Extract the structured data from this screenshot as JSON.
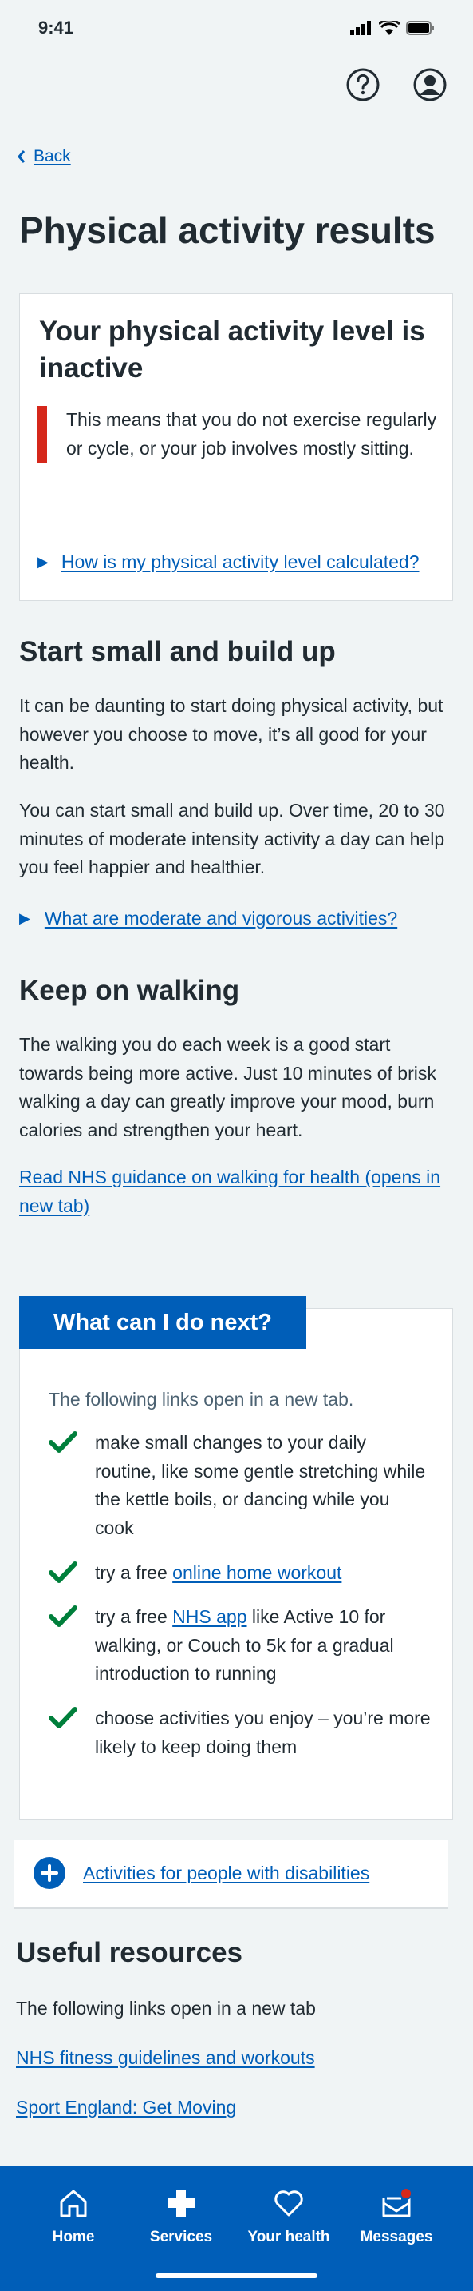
{
  "status": {
    "time": "9:41"
  },
  "nav": {
    "back": "Back"
  },
  "page": {
    "title": "Physical activity results"
  },
  "result_card": {
    "heading": "Your physical activity level is inactive",
    "inset": "This means that you do not exercise regularly or cycle, or your job involves mostly sitting.",
    "details_link": "How is my physical activity level calculated?"
  },
  "start_small": {
    "heading": "Start small and build up",
    "p1": "It can be daunting to start doing physical activity, but however you choose to move, it’s all good for your health.",
    "p2": "You can start small and build up. Over time, 20 to 30 minutes of moderate intensity activity a day can help you feel happier and healthier.",
    "details_link": "What are moderate and vigorous activities?"
  },
  "walking": {
    "heading": "Keep on walking",
    "p1": "The walking you do each week is a good start towards being more active. Just 10 minutes of brisk walking a day can greatly improve your mood, burn calories and strengthen your heart.",
    "link": "Read NHS guidance on walking for health (opens in new tab)"
  },
  "next": {
    "label": "What can I do next?",
    "intro": "The following links open in a new tab.",
    "items": [
      {
        "text": "make small changes to your daily routine, like some gentle stretching while the kettle boils, or dancing while you cook"
      },
      {
        "pre": "try a free ",
        "link": "online home workout",
        "post": ""
      },
      {
        "pre": "try a free ",
        "link": "NHS app",
        "post": " like Active 10 for walking, or Couch to 5k for a gradual introduction to running"
      },
      {
        "text": "choose activities you enjoy – you’re more likely to keep doing them"
      }
    ]
  },
  "expander": {
    "label": "Activities for people with disabilities"
  },
  "resources": {
    "heading": "Useful resources",
    "intro": "The following links open in a new tab",
    "link1": "NHS fitness guidelines and workouts",
    "link2": "Sport England: Get Moving"
  },
  "tabbar": {
    "home": "Home",
    "services": "Services",
    "your_health": "Your health",
    "messages": "Messages"
  },
  "colors": {
    "brand": "#005eb8",
    "alert": "#d5281b",
    "tick": "#007f3b",
    "background": "#f0f4f5"
  }
}
